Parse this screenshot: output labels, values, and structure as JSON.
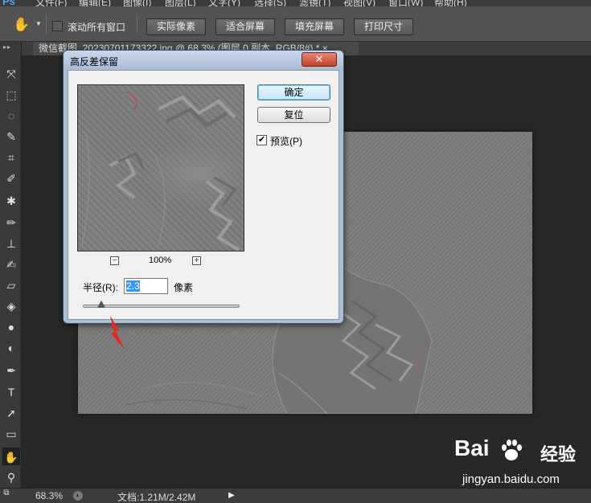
{
  "menubar": {
    "logo": "Ps",
    "items": [
      "文件(F)",
      "编辑(E)",
      "图像(I)",
      "图层(L)",
      "文字(Y)",
      "选择(S)",
      "滤镜(T)",
      "视图(V)",
      "窗口(W)",
      "帮助(H)"
    ]
  },
  "options_bar": {
    "tool_icon": "hand-icon",
    "scroll_all_windows_label": "滚动所有窗口",
    "scroll_all_windows_checked": false,
    "buttons": [
      "实际像素",
      "适合屏幕",
      "填充屏幕",
      "打印尺寸"
    ]
  },
  "document_tab": {
    "title": "微信截图_20230701173322.jpg @ 68.3% (图层 0 副本, RGB/8#) * ×"
  },
  "toolbar": {
    "tools": [
      "move-icon",
      "marquee-icon",
      "lasso-icon",
      "quick-selection-icon",
      "crop-icon",
      "eyedropper-icon",
      "healing-brush-icon",
      "brush-icon",
      "clone-stamp-icon",
      "history-brush-icon",
      "eraser-icon",
      "paint-bucket-icon",
      "blur-icon",
      "dodge-icon",
      "pen-icon",
      "type-icon",
      "path-selection-icon",
      "rectangle-icon",
      "hand-icon",
      "zoom-icon"
    ],
    "active_tool": "hand-icon"
  },
  "status_bar": {
    "zoom": "68.3%",
    "doc_info": "文档:1.21M/2.42M"
  },
  "dialog": {
    "title": "高反差保留",
    "close_label": "✕",
    "ok_label": "确定",
    "reset_label": "复位",
    "preview_label": "预览(P)",
    "preview_checked": true,
    "zoom_out": "−",
    "zoom_in": "+",
    "zoom_level": "100%",
    "radius_label": "半径(R):",
    "radius_value": "2.3",
    "radius_unit": "像素",
    "slider_level": 0.12
  },
  "watermark": {
    "logo": "Bai",
    "logo_suffix": "经验",
    "url": "jingyan.baidu.com"
  },
  "annotation": {
    "arrow_color": "#e8271c"
  }
}
